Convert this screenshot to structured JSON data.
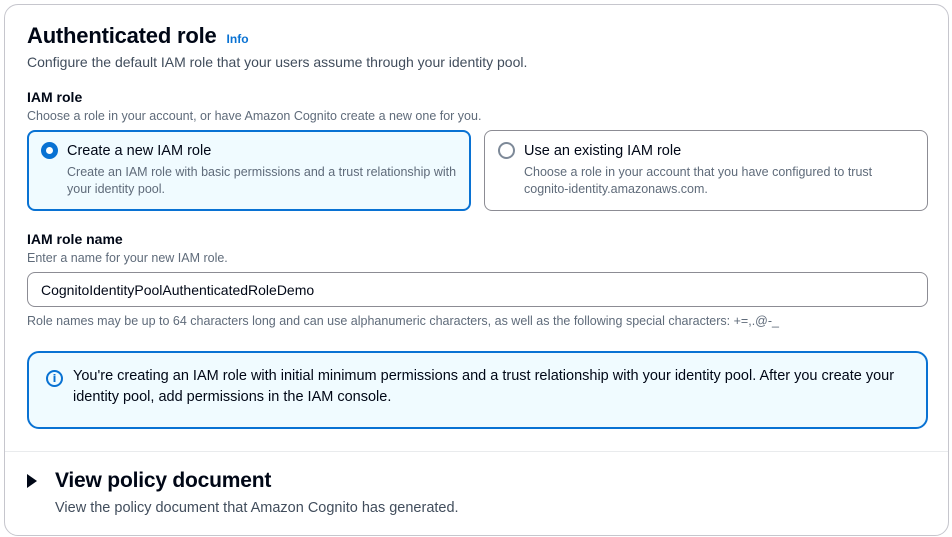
{
  "section": {
    "title": "Authenticated role",
    "info_link": "Info",
    "description": "Configure the default IAM role that your users assume through your identity pool."
  },
  "iam_role": {
    "label": "IAM role",
    "description": "Choose a role in your account, or have Amazon Cognito create a new one for you.",
    "options": [
      {
        "title": "Create a new IAM role",
        "description": "Create an IAM role with basic permissions and a trust relationship with your identity pool.",
        "selected": true
      },
      {
        "title": "Use an existing IAM role",
        "description": "Choose a role in your account that you have configured to trust cognito-identity.amazonaws.com.",
        "selected": false
      }
    ]
  },
  "role_name": {
    "label": "IAM role name",
    "description": "Enter a name for your new IAM role.",
    "value": "CognitoIdentityPoolAuthenticatedRoleDemo",
    "constraint": "Role names may be up to 64 characters long and can use alphanumeric characters, as well as the following special characters: +=,.@-_"
  },
  "alert": {
    "icon": "info-icon",
    "text": "You're creating an IAM role with initial minimum permissions and a trust relationship with your identity pool. After you create your identity pool, add permissions in the IAM console."
  },
  "policy_expander": {
    "icon": "caret-right-icon",
    "title": "View policy document",
    "description": "View the policy document that Amazon Cognito has generated."
  },
  "colors": {
    "accent": "#0972d3",
    "selected_background": "#f0fbff",
    "text": "#000716",
    "secondary_text": "#5f6b7a"
  }
}
